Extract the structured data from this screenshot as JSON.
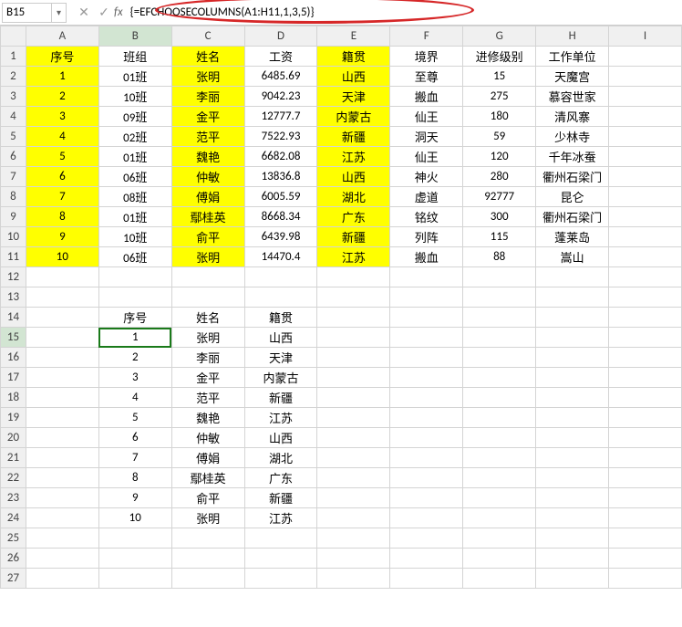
{
  "formula_bar": {
    "name_box": "B15",
    "formula": "{=EFCHOOSECOLUMNS(A1:H11,1,3,5)}"
  },
  "columns": [
    "A",
    "B",
    "C",
    "D",
    "E",
    "F",
    "G",
    "H",
    "I"
  ],
  "rows": [
    "1",
    "2",
    "3",
    "4",
    "5",
    "6",
    "7",
    "8",
    "9",
    "10",
    "11",
    "12",
    "13",
    "14",
    "15",
    "16",
    "17",
    "18",
    "19",
    "20",
    "21",
    "22",
    "23",
    "24",
    "25",
    "26",
    "27"
  ],
  "active_cell": "B15",
  "main_table": {
    "header": [
      "序号",
      "班组",
      "姓名",
      "工资",
      "籍贯",
      "境界",
      "进修级别",
      "工作单位"
    ],
    "rows": [
      [
        "1",
        "01班",
        "张明",
        "6485.69",
        "山西",
        "至尊",
        "15",
        "天魔宫"
      ],
      [
        "2",
        "10班",
        "李丽",
        "9042.23",
        "天津",
        "搬血",
        "275",
        "慕容世家"
      ],
      [
        "3",
        "09班",
        "金平",
        "12777.7",
        "内蒙古",
        "仙王",
        "180",
        "清风寨"
      ],
      [
        "4",
        "02班",
        "范平",
        "7522.93",
        "新疆",
        "洞天",
        "59",
        "少林寺"
      ],
      [
        "5",
        "01班",
        "魏艳",
        "6682.08",
        "江苏",
        "仙王",
        "120",
        "千年冰蚕"
      ],
      [
        "6",
        "06班",
        "仲敏",
        "13836.8",
        "山西",
        "神火",
        "280",
        "衢州石梁门"
      ],
      [
        "7",
        "08班",
        "傅娟",
        "6005.59",
        "湖北",
        "虚道",
        "92777",
        "昆仑"
      ],
      [
        "8",
        "01班",
        "鄢桂英",
        "8668.34",
        "广东",
        "铭纹",
        "300",
        "衢州石梁门"
      ],
      [
        "9",
        "10班",
        "俞平",
        "6439.98",
        "新疆",
        "列阵",
        "115",
        "蓬莱岛"
      ],
      [
        "10",
        "06班",
        "张明",
        "14470.4",
        "江苏",
        "搬血",
        "88",
        "嵩山"
      ]
    ]
  },
  "result_table": {
    "header": [
      "序号",
      "姓名",
      "籍贯"
    ],
    "rows": [
      [
        "1",
        "张明",
        "山西"
      ],
      [
        "2",
        "李丽",
        "天津"
      ],
      [
        "3",
        "金平",
        "内蒙古"
      ],
      [
        "4",
        "范平",
        "新疆"
      ],
      [
        "5",
        "魏艳",
        "江苏"
      ],
      [
        "6",
        "仲敏",
        "山西"
      ],
      [
        "7",
        "傅娟",
        "湖北"
      ],
      [
        "8",
        "鄢桂英",
        "广东"
      ],
      [
        "9",
        "俞平",
        "新疆"
      ],
      [
        "10",
        "张明",
        "江苏"
      ]
    ]
  },
  "chart_data": {
    "type": "table",
    "title": "",
    "tables": [
      {
        "name": "main",
        "columns": [
          "序号",
          "班组",
          "姓名",
          "工资",
          "籍贯",
          "境界",
          "进修级别",
          "工作单位"
        ],
        "rows": [
          [
            1,
            "01班",
            "张明",
            6485.69,
            "山西",
            "至尊",
            15,
            "天魔宫"
          ],
          [
            2,
            "10班",
            "李丽",
            9042.23,
            "天津",
            "搬血",
            275,
            "慕容世家"
          ],
          [
            3,
            "09班",
            "金平",
            12777.7,
            "内蒙古",
            "仙王",
            180,
            "清风寨"
          ],
          [
            4,
            "02班",
            "范平",
            7522.93,
            "新疆",
            "洞天",
            59,
            "少林寺"
          ],
          [
            5,
            "01班",
            "魏艳",
            6682.08,
            "江苏",
            "仙王",
            120,
            "千年冰蚕"
          ],
          [
            6,
            "06班",
            "仲敏",
            13836.8,
            "山西",
            "神火",
            280,
            "衢州石梁门"
          ],
          [
            7,
            "08班",
            "傅娟",
            6005.59,
            "湖北",
            "虚道",
            92777,
            "昆仑"
          ],
          [
            8,
            "01班",
            "鄢桂英",
            8668.34,
            "广东",
            "铭纹",
            300,
            "衢州石梁门"
          ],
          [
            9,
            "10班",
            "俞平",
            6439.98,
            "新疆",
            "列阵",
            115,
            "蓬莱岛"
          ],
          [
            10,
            "06班",
            "张明",
            14470.4,
            "江苏",
            "搬血",
            88,
            "嵩山"
          ]
        ]
      },
      {
        "name": "result",
        "columns": [
          "序号",
          "姓名",
          "籍贯"
        ],
        "rows": [
          [
            1,
            "张明",
            "山西"
          ],
          [
            2,
            "李丽",
            "天津"
          ],
          [
            3,
            "金平",
            "内蒙古"
          ],
          [
            4,
            "范平",
            "新疆"
          ],
          [
            5,
            "魏艳",
            "江苏"
          ],
          [
            6,
            "仲敏",
            "山西"
          ],
          [
            7,
            "傅娟",
            "湖北"
          ],
          [
            8,
            "鄢桂英",
            "广东"
          ],
          [
            9,
            "俞平",
            "新疆"
          ],
          [
            10,
            "张明",
            "江苏"
          ]
        ]
      }
    ]
  }
}
